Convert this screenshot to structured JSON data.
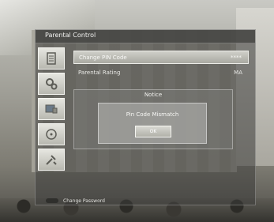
{
  "window": {
    "title": "Parental Control"
  },
  "menu": {
    "items": [
      {
        "label": "Change PIN Code",
        "value": "****",
        "selected": true
      },
      {
        "label": "Parental Rating",
        "value": "MA",
        "selected": false
      }
    ]
  },
  "sidebar": {
    "icons": [
      "document-icon",
      "gears-icon",
      "tv-icon",
      "disc-icon",
      "tools-icon"
    ]
  },
  "dialog": {
    "title": "Notice",
    "message": "Pin Code Mismatch",
    "ok_label": "OK"
  },
  "footer": {
    "hint": "Change Password",
    "button_color": "#2f2f2c"
  },
  "colors": {
    "panel": "#3c3c3a",
    "highlight": "#bdbdb6",
    "text": "#f2f2f0"
  }
}
